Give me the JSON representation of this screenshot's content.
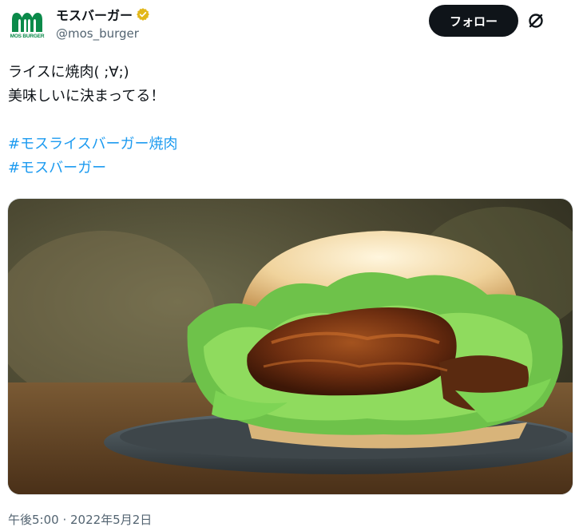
{
  "account": {
    "logo_text": "MOS BURGER",
    "display_name": "モスバーガー",
    "handle": "@mos_burger",
    "verified": true,
    "avatar_color": "#0b8a4a"
  },
  "actions": {
    "follow_label": "フォロー"
  },
  "tweet": {
    "lines": [
      "ライスに焼肉( ;∀;)",
      "美味しいに決まってる！"
    ],
    "hashtags": [
      "#モスライスバーガー焼肉",
      "#モスバーガー"
    ],
    "media": {
      "description_icon": "photo",
      "subject": "rice-burger-yakiniku"
    },
    "timestamp": "午後5:00 · 2022年5月2日"
  },
  "colors": {
    "link": "#1d9bf0",
    "text": "#0f1419",
    "muted": "#536471",
    "verified_badge": "#e2b719"
  }
}
